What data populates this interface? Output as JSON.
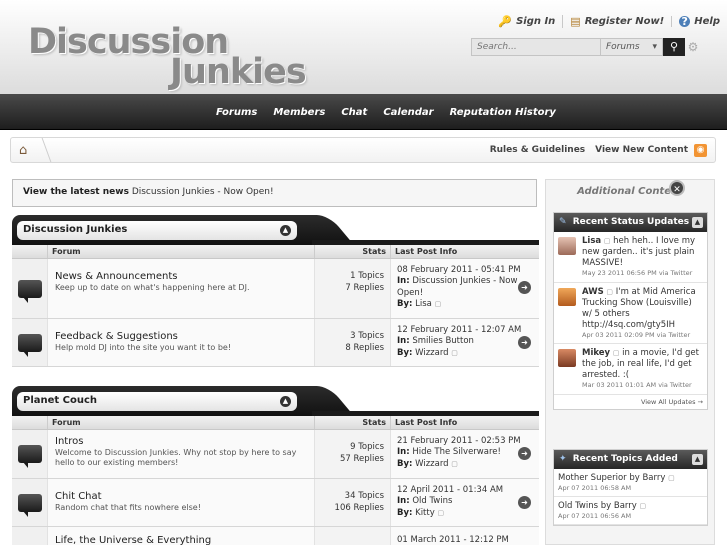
{
  "header": {
    "logo_line1": "Discussion",
    "logo_line2": "Junkies",
    "sign_in": "Sign In",
    "register": "Register Now!",
    "help": "Help",
    "search_placeholder": "Search...",
    "search_scope": "Forums"
  },
  "nav": [
    "Forums",
    "Members",
    "Chat",
    "Calendar",
    "Reputation History"
  ],
  "breadcrumb": {
    "rules": "Rules & Guidelines",
    "new_content": "View New Content"
  },
  "news": {
    "label": "View the latest news",
    "text": "Discussion Junkies - Now Open!"
  },
  "columns": {
    "forum": "Forum",
    "stats": "Stats",
    "last": "Last Post Info"
  },
  "labels": {
    "in": "In:",
    "by": "By:"
  },
  "categories": [
    {
      "title": "Discussion Junkies",
      "forums": [
        {
          "name": "News & Announcements",
          "desc": "Keep up to date on what's happening here at DJ.",
          "topics": "1 Topics",
          "replies": "7 Replies",
          "date": "08 February 2011 - 05:41 PM",
          "in": "Discussion Junkies - Now Open!",
          "by": "Lisa"
        },
        {
          "name": "Feedback & Suggestions",
          "desc": "Help mold DJ into the site you want it to be!",
          "topics": "3 Topics",
          "replies": "8 Replies",
          "date": "12 February 2011 - 12:07 AM",
          "in": "Smilies Button",
          "by": "Wizzard"
        }
      ]
    },
    {
      "title": "Planet Couch",
      "forums": [
        {
          "name": "Intros",
          "desc": "Welcome to Discussion Junkies. Why not stop by here to say hello to our existing members!",
          "topics": "9 Topics",
          "replies": "57 Replies",
          "date": "21 February 2011 - 02:53 PM",
          "in": "Hide The Silverware!",
          "by": "Wizzard"
        },
        {
          "name": "Chit Chat",
          "desc": "Random chat that fits nowhere else!",
          "topics": "34 Topics",
          "replies": "106 Replies",
          "date": "12 April 2011 - 01:34 AM",
          "in": "Old Twins",
          "by": "Kitty"
        },
        {
          "name": "Life, the Universe & Everything",
          "desc": "",
          "topics": "",
          "replies": "",
          "date": "01 March 2011 - 12:12 PM",
          "in": "",
          "by": ""
        }
      ]
    }
  ],
  "sidebar": {
    "title": "Additional Content",
    "status_title": "Recent Status Updates",
    "statuses": [
      {
        "who": "Lisa",
        "text": "heh heh.. I love my new garden.. it's just plain MASSIVE!",
        "when": "May 23 2011 06:56 PM via Twitter",
        "color": "#c99a86"
      },
      {
        "who": "AWS",
        "text": "I'm at Mid America Trucking Show (Louisville) w/ 5 others http://4sq.com/gty5IH",
        "when": "Apr 03 2011 02:09 PM via Twitter",
        "color": "#d2823a"
      },
      {
        "who": "Mikey",
        "text": "in a movie, I'd get the job, in real life, I'd get arrested. :(",
        "when": "Mar 03 2011 01:01 AM via Twitter",
        "color": "#b5603e"
      }
    ],
    "view_all": "View All Updates →",
    "topics_title": "Recent Topics Added",
    "topics": [
      {
        "title": "Mother Superior by Barry",
        "date": "Apr 07 2011 06:58 AM"
      },
      {
        "title": "Old Twins by Barry",
        "date": "Apr 07 2011 06:56 AM"
      }
    ]
  }
}
